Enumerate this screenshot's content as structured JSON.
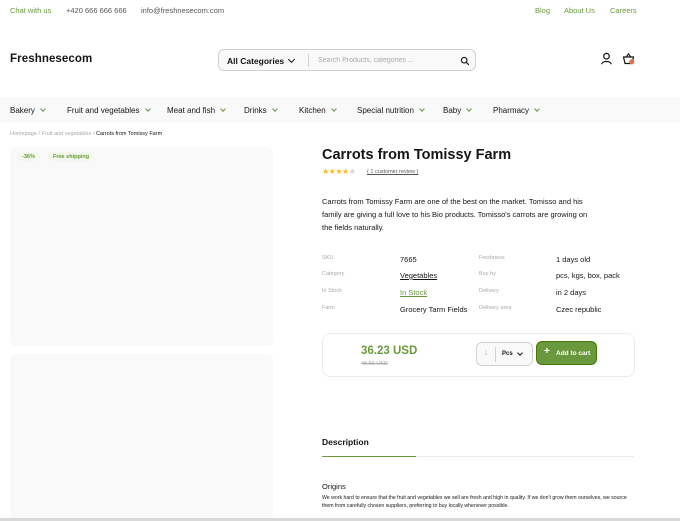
{
  "topbar": {
    "chat": "Chat with us",
    "phone": "+420 666 666 666",
    "email": "info@freshnesecom.com",
    "links": [
      "Blog",
      "About Us",
      "Careers"
    ]
  },
  "header": {
    "logo": "Freshnesecom",
    "category": "All Categories",
    "search_placeholder": "Search Products, categories ...",
    "icons": [
      "search-icon",
      "user-icon",
      "basket-icon"
    ]
  },
  "nav": {
    "items": [
      {
        "label": "Bakery"
      },
      {
        "label": "Fruit and vegetables"
      },
      {
        "label": "Meat and fish"
      },
      {
        "label": "Drinks"
      },
      {
        "label": "Kitchen"
      },
      {
        "label": "Special nutrition"
      },
      {
        "label": "Baby"
      },
      {
        "label": "Pharmacy"
      }
    ]
  },
  "breadcrumb": {
    "items": [
      "Homepage /",
      "Fruit and vegetables /"
    ],
    "current": "Carrots from Tomissy Farm"
  },
  "gallery": {
    "discount": "-36%",
    "shipping": "Free shipping"
  },
  "product": {
    "title": "Carrots from Tomissy Farm",
    "rating": 4,
    "rating_max": 5,
    "review": "( 1 customer review )",
    "description": "Carrots from Tomissy Farm are one of the best on the market. Tomisso and his family are giving a full love to his Bio products. Tomisso's carrots are growing on the fields naturally.",
    "specs_left": [
      {
        "label": "SKU",
        "value": "7665"
      },
      {
        "label": "Category",
        "value": "Vegetables"
      },
      {
        "label": "In Stock",
        "value": "In Stock"
      },
      {
        "label": "Farm",
        "value": "Grocery Tarm Fields"
      }
    ],
    "specs_right": [
      {
        "label": "Freshness",
        "value": "1 days old"
      },
      {
        "label": "Buy by",
        "value": "pcs, kgs, box, pack"
      },
      {
        "label": "Delivery",
        "value": "in 2 days"
      },
      {
        "label": "Delivery area",
        "value": "Czec republic"
      }
    ],
    "price": "36.23 USD",
    "old_price": "48.56 USD",
    "quantity": "1",
    "unit": "Pcs",
    "add_to_cart": "Add to cart"
  },
  "tabs": {
    "description": "Description"
  },
  "content": {
    "origins_heading": "Origins",
    "origins_text": "We work hard to ensure that the fruit and vegetables we sell are fresh and high in quality. If we don't grow them ourselves, we source them from carefully chosen suppliers, preferring to buy locally whenever possible."
  },
  "colors": {
    "accent": "#6a983c",
    "accent_dark": "#46760a",
    "star": "#fdbc15",
    "text": "#151515",
    "muted": "#a9a9a9",
    "panel": "#f9f9f9"
  }
}
